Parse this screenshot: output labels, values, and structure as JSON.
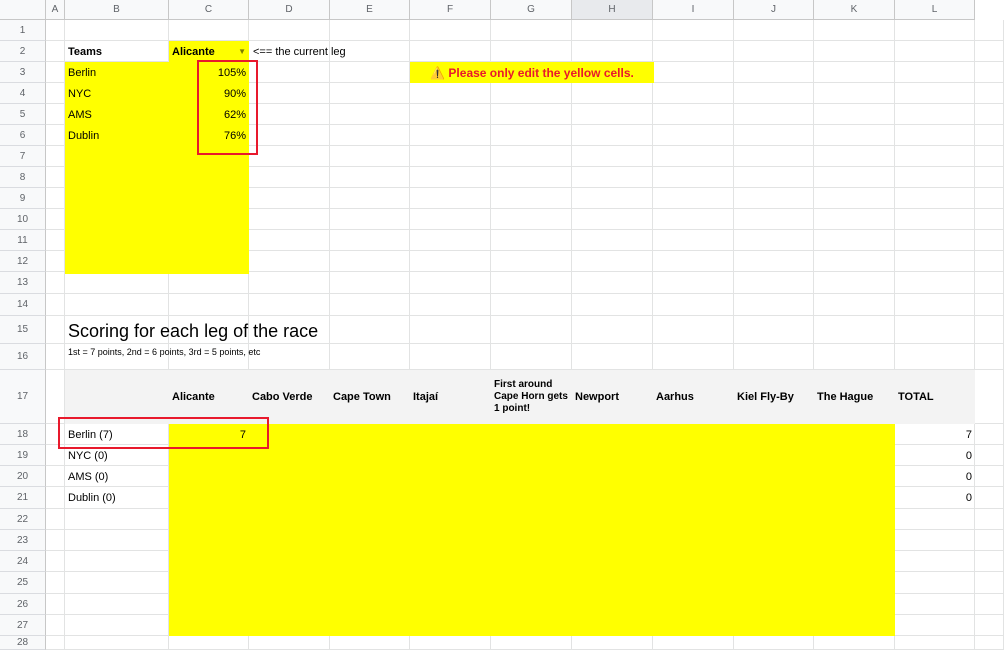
{
  "columns": [
    "A",
    "B",
    "C",
    "D",
    "E",
    "F",
    "G",
    "H",
    "I",
    "J",
    "K",
    "L"
  ],
  "rows": [
    "1",
    "2",
    "3",
    "4",
    "5",
    "6",
    "7",
    "8",
    "9",
    "10",
    "11",
    "12",
    "13",
    "14",
    "15",
    "16",
    "17",
    "18",
    "19",
    "20",
    "21",
    "22",
    "23",
    "24",
    "25",
    "26",
    "27",
    "28"
  ],
  "teams_table": {
    "header_label": "Teams",
    "leg_selected": "Alicante",
    "leg_note": "<== the current leg",
    "teams": [
      {
        "name": "Berlin",
        "pct": "105%"
      },
      {
        "name": "NYC",
        "pct": "90%"
      },
      {
        "name": "AMS",
        "pct": "62%"
      },
      {
        "name": "Dublin",
        "pct": "76%"
      }
    ]
  },
  "warning": {
    "icon": "warning-icon",
    "text": "⚠️ Please only edit the yellow cells."
  },
  "scoring": {
    "title": "Scoring for each leg of the race",
    "subtitle": "1st = 7 points, 2nd = 6 points, 3rd = 5 points, etc",
    "headers": [
      "Alicante",
      "Cabo Verde",
      "Cape Town",
      "Itajaí",
      "First around Cape Horn gets 1 point!",
      "Newport",
      "Aarhus",
      "Kiel Fly-By",
      "The Hague",
      "TOTAL"
    ],
    "rows": [
      {
        "label": "Berlin (7)",
        "alicante": "7",
        "total": "7"
      },
      {
        "label": "NYC (0)",
        "alicante": "",
        "total": "0"
      },
      {
        "label": "AMS (0)",
        "alicante": "",
        "total": "0"
      },
      {
        "label": "Dublin (0)",
        "alicante": "",
        "total": "0"
      }
    ]
  },
  "colors": {
    "yellow": "#ffff00",
    "highlight_red": "#e8192c",
    "warning_red": "#e8192c"
  }
}
